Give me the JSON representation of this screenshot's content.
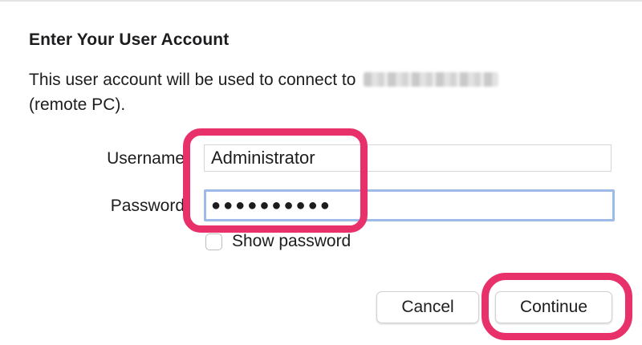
{
  "dialog": {
    "title": "Enter Your User Account",
    "message_prefix": "This user account will be used to connect to",
    "message_suffix": "(remote PC)."
  },
  "form": {
    "username_label": "Username",
    "username_value": "Administrator",
    "password_label": "Password",
    "password_value": "●●●●●●●●●●",
    "show_password_label": "Show password",
    "show_password_checked": false
  },
  "buttons": {
    "cancel_label": "Cancel",
    "continue_label": "Continue"
  },
  "colors": {
    "highlight": "#e8316a",
    "focus_ring": "#9dbbe9"
  }
}
